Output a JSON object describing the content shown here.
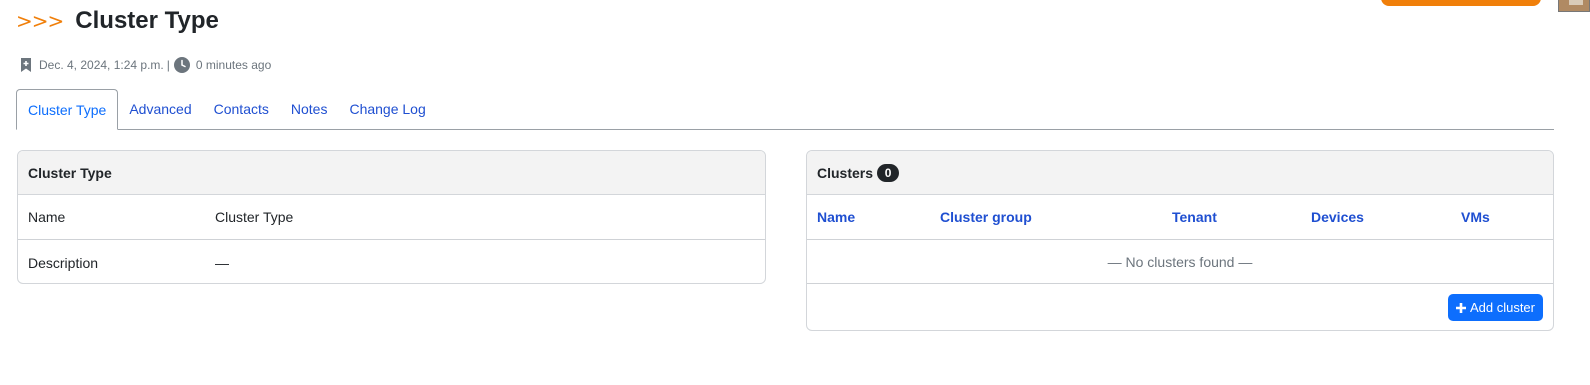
{
  "header": {
    "breadcrumb_marker": ">>>",
    "title": "Cluster Type",
    "created": "Dec. 4, 2024, 1:24 p.m.",
    "separator": "|",
    "updated": "0 minutes ago"
  },
  "tabs": [
    {
      "label": "Cluster Type",
      "active": true
    },
    {
      "label": "Advanced"
    },
    {
      "label": "Contacts"
    },
    {
      "label": "Notes"
    },
    {
      "label": "Change Log"
    }
  ],
  "details_card": {
    "title": "Cluster Type",
    "rows": [
      {
        "label": "Name",
        "value": "Cluster Type"
      },
      {
        "label": "Description",
        "value": "—"
      }
    ]
  },
  "clusters_card": {
    "title": "Clusters",
    "count": "0",
    "columns": [
      "Name",
      "Cluster group",
      "Tenant",
      "Devices",
      "VMs"
    ],
    "empty_message": "— No clusters found —",
    "add_button": "Add cluster"
  },
  "colors": {
    "accent_orange": "#f07f0a",
    "link_blue": "#1f4fd1",
    "primary_blue": "#0d6efd",
    "badge_dark": "#212529"
  },
  "icons": {
    "created": "bookmark-plus-icon",
    "updated": "clock-icon",
    "add": "plus-icon"
  }
}
